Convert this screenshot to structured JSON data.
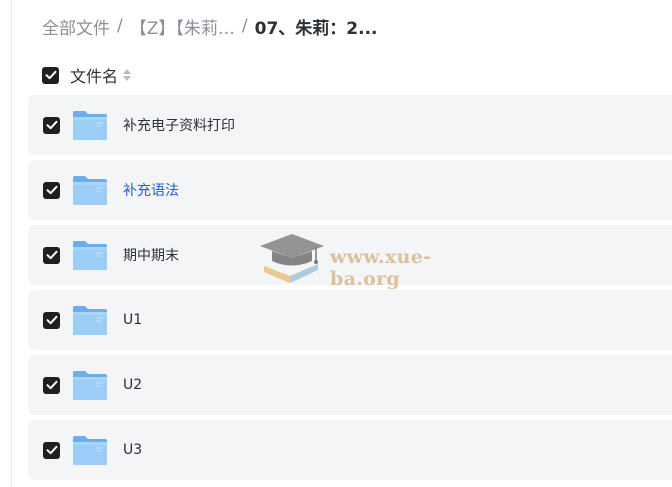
{
  "breadcrumb": {
    "items": [
      "全部文件",
      "【Z】【朱莉…"
    ],
    "separator": "/",
    "current": "07、朱莉：2..."
  },
  "header": {
    "column_label": "文件名",
    "select_all_checked": true,
    "sort_icon": "sort-updown-icon"
  },
  "files": [
    {
      "name": "补充电子资料打印",
      "checked": true,
      "highlighted": false,
      "icon": "folder-icon"
    },
    {
      "name": "补充语法",
      "checked": true,
      "highlighted": true,
      "icon": "folder-icon"
    },
    {
      "name": "期中期末",
      "checked": true,
      "highlighted": false,
      "icon": "folder-icon"
    },
    {
      "name": "U1",
      "checked": true,
      "highlighted": false,
      "icon": "folder-icon"
    },
    {
      "name": "U2",
      "checked": true,
      "highlighted": false,
      "icon": "folder-icon"
    },
    {
      "name": "U3",
      "checked": true,
      "highlighted": false,
      "icon": "folder-icon"
    }
  ],
  "watermark": {
    "text": "www.xue-ba.org",
    "icon": "graduation-cap-book-icon"
  },
  "colors": {
    "row_background": "#f4f5f7",
    "checkbox": "#1f1f1f",
    "folder": "#8cc4f5",
    "link": "#1b5fd9",
    "watermark": "#d9b98a"
  }
}
